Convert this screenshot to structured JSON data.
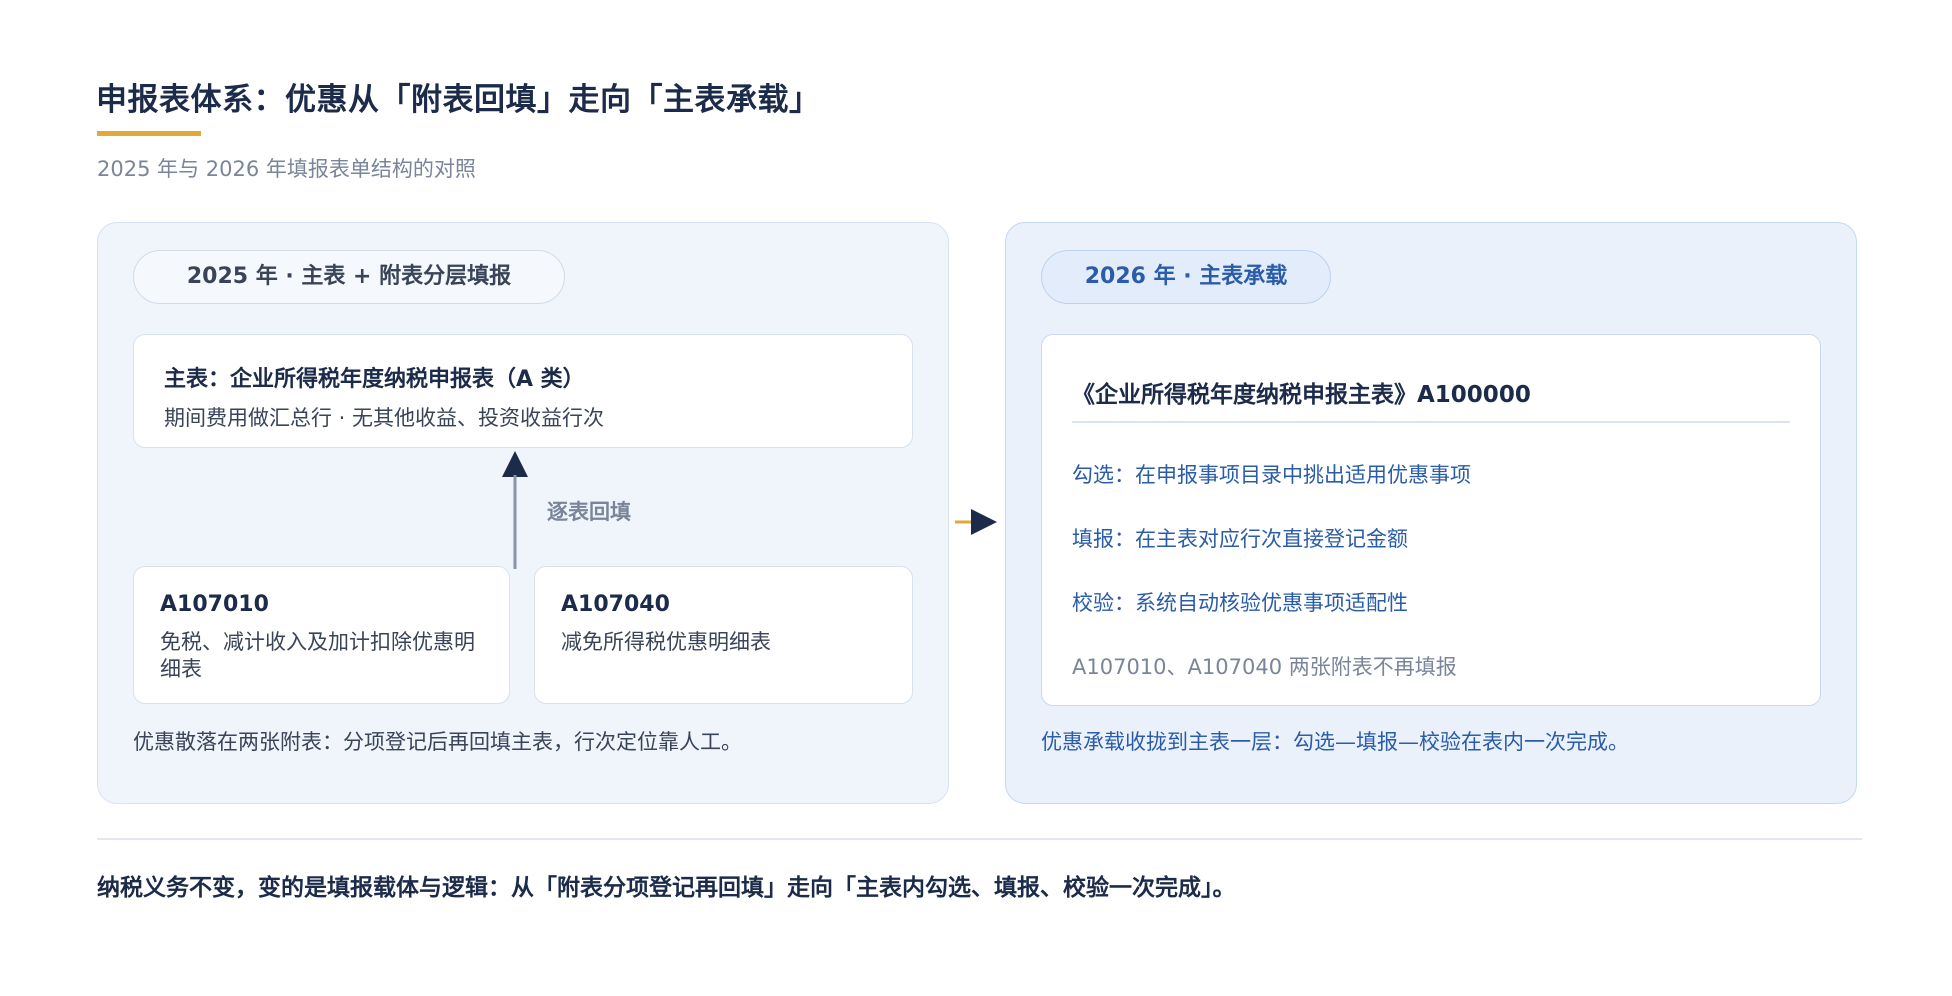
{
  "header": {
    "title": "申报表体系：优惠从「附表回填」走向「主表承载」",
    "subtitle": "2025 年与 2026 年填报表单结构的对照"
  },
  "left_panel": {
    "pill_label": "2025 年 · 主表 + 附表分层填报",
    "main_card": {
      "title": "主表：企业所得税年度纳税申报表（A 类）",
      "description": "期间费用做汇总行 · 无其他收益、投资收益行次"
    },
    "flow_label": "逐表回填",
    "sub_cards": [
      {
        "code": "A107010",
        "description": "免税、减计收入及加计扣除优惠明细表"
      },
      {
        "code": "A107040",
        "description": "减免所得税优惠明细表"
      }
    ],
    "note": "优惠散落在两张附表：分项登记后再回填主表，行次定位靠人工。"
  },
  "right_panel": {
    "pill_label": "2026 年 · 主表承载",
    "card": {
      "title": "《企业所得税年度纳税申报主表》A100000",
      "steps": [
        "勾选：在申报事项目录中挑出适用优惠事项",
        "填报：在主表对应行次直接登记金额",
        "校验：系统自动核验优惠事项适配性"
      ],
      "muted_note": "A107010、A107040 两张附表不再填报"
    },
    "note": "优惠承载收拢到主表一层：勾选—填报—校验在表内一次完成。"
  },
  "footer": {
    "conclusion": "纳税义务不变，变的是填报载体与逻辑：从「附表分项登记再回填」走向「主表内勾选、填报、校验一次完成」。"
  },
  "colors": {
    "navy": "#1c2b4a",
    "accent_gold": "#e1a93a",
    "blue": "#2b5ca8",
    "muted_gray": "#7a8599"
  }
}
